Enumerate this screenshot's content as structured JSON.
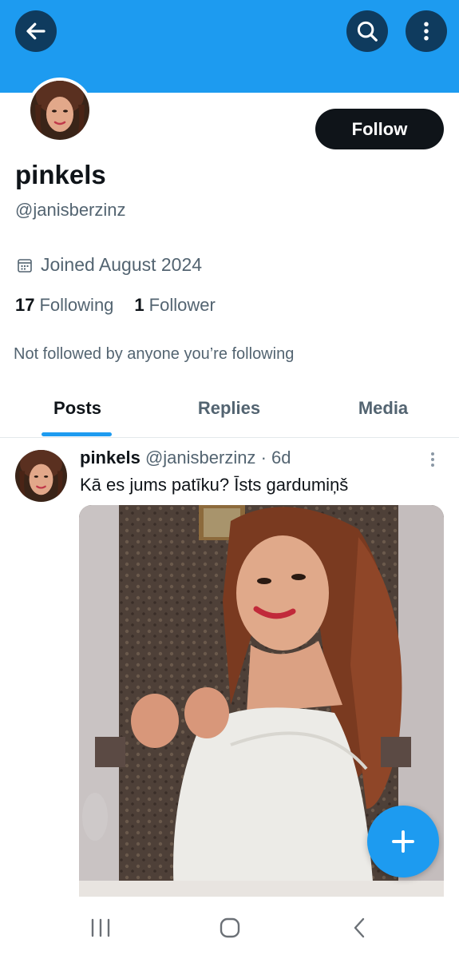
{
  "profile": {
    "display_name": "pinkels",
    "handle": "@janisberzinz",
    "follow_label": "Follow",
    "joined": "Joined August 2024",
    "following_count": "17",
    "following_label": "Following",
    "followers_count": "1",
    "followers_label": "Follower",
    "not_followed_note": "Not followed by anyone you’re following"
  },
  "tabs": [
    {
      "label": "Posts",
      "active": true
    },
    {
      "label": "Replies",
      "active": false
    },
    {
      "label": "Media",
      "active": false
    }
  ],
  "post": {
    "author_name": "pinkels",
    "author_handle": "@janisberzinz",
    "time": "· 6d",
    "text": "Kā es jums patīku? Īsts gardumiņš"
  },
  "icons": {
    "back": "arrow-left-icon",
    "search": "search-icon",
    "more": "more-vertical-icon",
    "calendar": "calendar-icon",
    "compose": "plus-icon",
    "nav_recents": "recents-icon",
    "nav_home": "home-icon",
    "nav_back": "chevron-left-icon"
  },
  "colors": {
    "banner": "#1d9bf0",
    "accent": "#1d9bf0",
    "header_button_bg": "#0f3b5e",
    "primary_text": "#0f1419",
    "secondary_text": "#536471"
  }
}
